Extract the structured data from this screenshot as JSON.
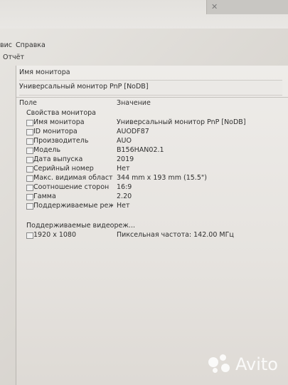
{
  "menu": {
    "service": "вис",
    "help": "Справка"
  },
  "toolbar": {
    "report": "Отчёт"
  },
  "monitor_header": {
    "label": "Имя монитора",
    "value": "Универсальный монитор PnP [NoDB]"
  },
  "table": {
    "col_field": "Поле",
    "col_value": "Значение",
    "group1": "Свойства монитора",
    "rows": [
      {
        "field": "Имя монитора",
        "value": "Универсальный монитор PnP [NoDB]"
      },
      {
        "field": "ID монитора",
        "value": "AUODF87"
      },
      {
        "field": "Производитель",
        "value": "AUO"
      },
      {
        "field": "Модель",
        "value": "B156HAN02.1"
      },
      {
        "field": "Дата выпуска",
        "value": "2019"
      },
      {
        "field": "Серийный номер",
        "value": "Нет"
      },
      {
        "field": "Макс. видимая область экр...",
        "value": "344 mm x 193 mm (15.5\")"
      },
      {
        "field": "Соотношение сторон",
        "value": "16:9"
      },
      {
        "field": "Гамма",
        "value": "2.20"
      },
      {
        "field": "Поддерживаемые режимы...",
        "value": "Нет"
      }
    ],
    "group2": "Поддерживаемые видеореж...",
    "mode": {
      "field": "1920 x 1080",
      "value": "Пиксельная частота: 142.00 МГц"
    }
  },
  "watermark": "Avito"
}
